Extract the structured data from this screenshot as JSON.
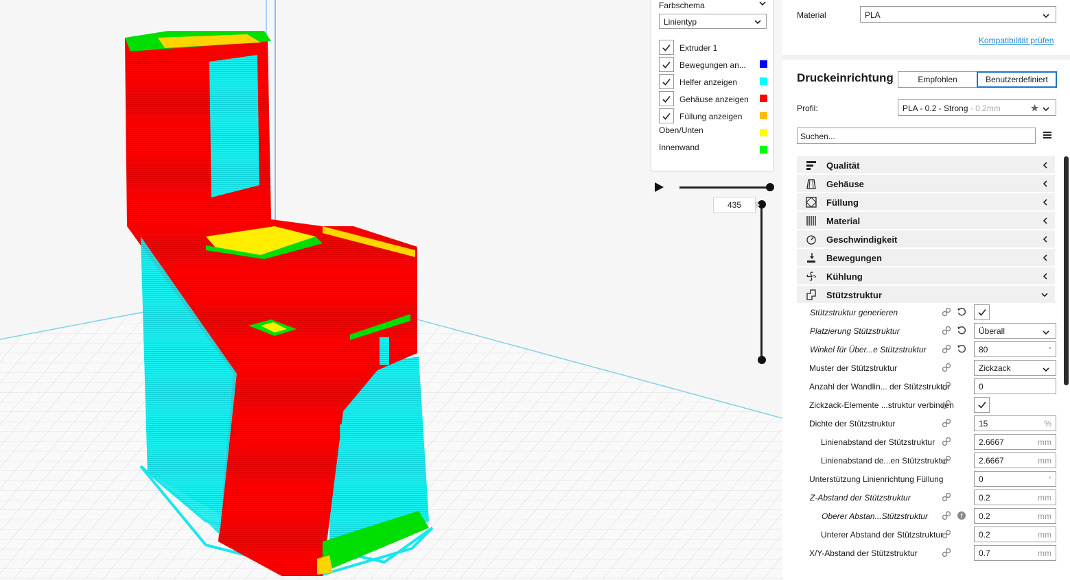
{
  "legend": {
    "color_scheme_label": "Farbschema",
    "line_type_value": "Linientyp",
    "items": [
      {
        "label": "Extruder 1",
        "checked": true,
        "color": ""
      },
      {
        "label": "Bewegungen an...",
        "checked": true,
        "color": "#0000ff"
      },
      {
        "label": "Helfer anzeigen",
        "checked": true,
        "color": "#00ffff"
      },
      {
        "label": "Gehäuse anzeigen",
        "checked": true,
        "color": "#ff0000"
      },
      {
        "label": "Füllung anzeigen",
        "checked": true,
        "color": "#ffbf00"
      },
      {
        "label": "Oben/Unten",
        "checked": false,
        "color": "#ffff00"
      },
      {
        "label": "Innenwand",
        "checked": false,
        "color": "#00ff00"
      }
    ]
  },
  "layer_slider": {
    "current_layer": "435"
  },
  "material": {
    "label": "Material",
    "value": "PLA",
    "compat_link": "Kompatibilität prüfen"
  },
  "print_setup": {
    "title": "Druckeinrichtung",
    "tab_recommended": "Empfohlen",
    "tab_custom": "Benutzerdefiniert",
    "profile_label": "Profil:",
    "profile_value": "PLA - 0.2 - Strong",
    "profile_suffix": "- 0.2mm",
    "search_placeholder": "Suchen..."
  },
  "categories": [
    {
      "label": "Qualität",
      "icon": "quality-icon"
    },
    {
      "label": "Gehäuse",
      "icon": "shell-icon"
    },
    {
      "label": "Füllung",
      "icon": "infill-icon"
    },
    {
      "label": "Material",
      "icon": "material-icon"
    },
    {
      "label": "Geschwindigkeit",
      "icon": "speed-icon"
    },
    {
      "label": "Bewegungen",
      "icon": "travel-icon"
    },
    {
      "label": "Kühlung",
      "icon": "cooling-icon"
    },
    {
      "label": "Stützstruktur",
      "icon": "support-icon"
    }
  ],
  "settings": [
    {
      "label": "Stützstruktur generieren",
      "type": "check",
      "value": "",
      "unit": ""
    },
    {
      "label": "Platzierung Stützstruktur",
      "type": "select",
      "value": "Überall",
      "unit": ""
    },
    {
      "label": "Winkel für Über...e Stützstruktur",
      "type": "input",
      "value": "80",
      "unit": "°"
    },
    {
      "label": "Muster der Stützstruktur",
      "type": "select",
      "value": "Zickzack",
      "unit": ""
    },
    {
      "label": "Anzahl der Wandlin... der Stützstruktur",
      "type": "input",
      "value": "0",
      "unit": ""
    },
    {
      "label": "Zickzack-Elemente ...struktur verbinden",
      "type": "check",
      "value": "",
      "unit": ""
    },
    {
      "label": "Dichte der Stützstruktur",
      "type": "input",
      "value": "15",
      "unit": "%"
    },
    {
      "label": "Linienabstand der Stützstruktur",
      "type": "input",
      "value": "2.6667",
      "unit": "mm"
    },
    {
      "label": "Linienabstand de...en Stützstruktur",
      "type": "input",
      "value": "2.6667",
      "unit": "mm"
    },
    {
      "label": "Unterstützung Linienrichtung Füllung",
      "type": "input",
      "value": "0",
      "unit": "°"
    },
    {
      "label": "Z-Abstand der Stützstruktur",
      "type": "input",
      "value": "0.2",
      "unit": "mm"
    },
    {
      "label": "Oberer Abstan...Stützstruktur",
      "type": "input",
      "value": "0.2",
      "unit": "mm"
    },
    {
      "label": "Unterer Abstand der Stützstruktur",
      "type": "input",
      "value": "0.2",
      "unit": "mm"
    },
    {
      "label": "X/Y-Abstand der Stützstruktur",
      "type": "input",
      "value": "0.7",
      "unit": "mm"
    }
  ]
}
